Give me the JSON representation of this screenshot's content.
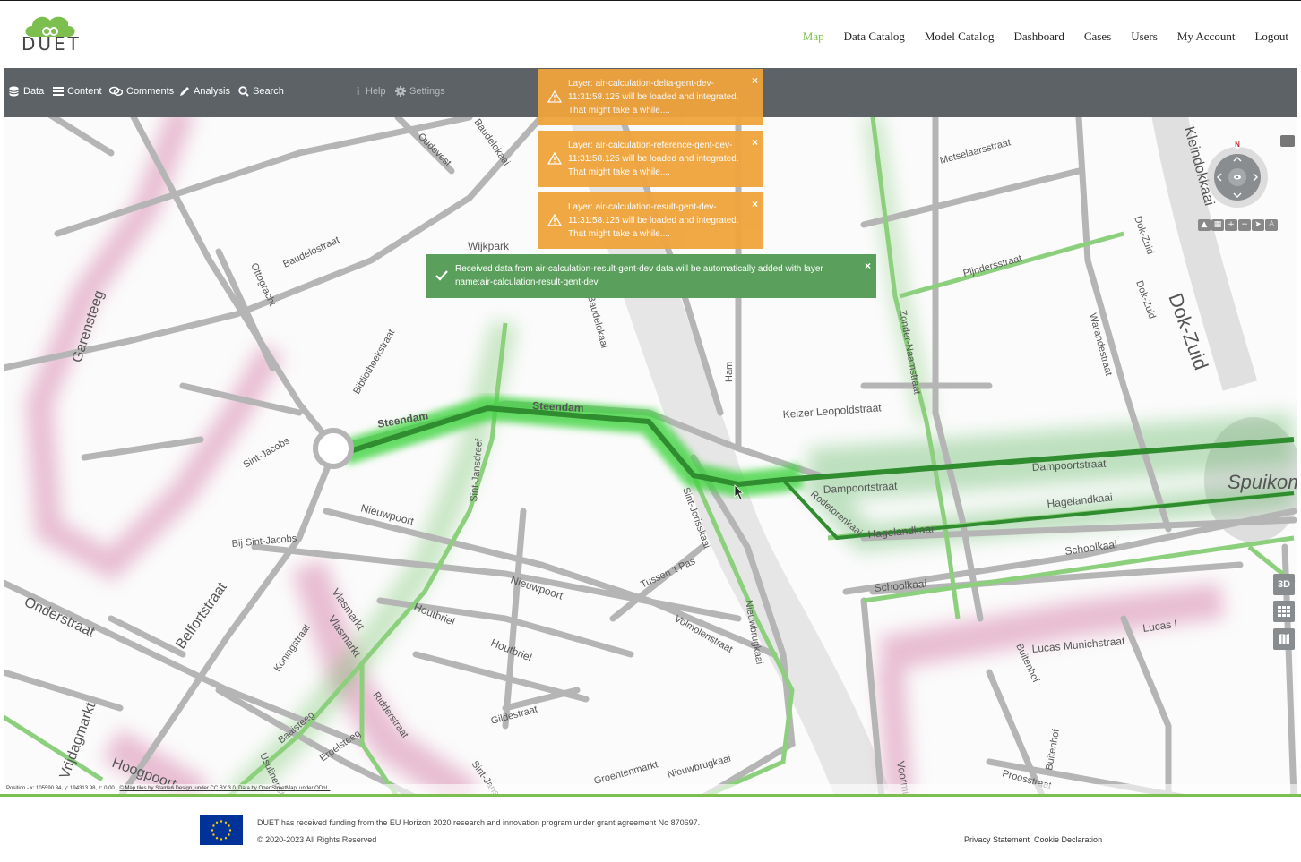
{
  "brand": {
    "logo_text": "DUET"
  },
  "nav": {
    "items": [
      {
        "label": "Map",
        "active": true
      },
      {
        "label": "Data Catalog"
      },
      {
        "label": "Model Catalog"
      },
      {
        "label": "Dashboard"
      },
      {
        "label": "Cases"
      },
      {
        "label": "Users"
      },
      {
        "label": "My Account"
      },
      {
        "label": "Logout"
      }
    ]
  },
  "toolbar": {
    "data": "Data",
    "content": "Content",
    "comments": "Comments",
    "analysis": "Analysis",
    "search": "Search",
    "help": "Help",
    "settings": "Settings"
  },
  "notifications": [
    {
      "text": "Layer: air-calculation-delta-gent-dev-11:31:58.125 will be loaded and integrated. That might take a while....",
      "type": "warning"
    },
    {
      "text": "Layer: air-calculation-reference-gent-dev-11:31:58.125 will be loaded and integrated. That might take a while....",
      "type": "warning"
    },
    {
      "text": "Layer: air-calculation-result-gent-dev-11:31:58.125 will be loaded and integrated. That might take a while....",
      "type": "warning"
    }
  ],
  "success": {
    "text": "Received data from air-calculation-result-gent-dev data will be automatically added with layer name:air-calculation-result-gent-dev"
  },
  "map": {
    "compass_north": "N",
    "side_buttons": {
      "three_d": "3D"
    },
    "position_readout": "Position - x: 105590.34, y: 194313.98, z: 0.00",
    "attribution": "© Map tiles by Stamen Design, under CC BY 3.0. Data by OpenStreetMap, under ODbL.",
    "street_labels": [
      "Steendam",
      "Steendam",
      "Sint-Jansdreef",
      "Sint-Jorisskaai",
      "Nieuwpoort",
      "Nieuwpoort",
      "Houtbriel",
      "Houtbriel",
      "Gildestraat",
      "Vlasmarkt",
      "Vlasmarkt",
      "Koningstraat",
      "Baaisteeg",
      "Erpelsteeg",
      "Ridderstraat",
      "Belfortstraat",
      "Onderstraat",
      "Hoogpoort",
      "Garensteeg",
      "Baudelostraat",
      "Oudevest",
      "Baudelokaai",
      "Baudelokaai",
      "Bibliotheekstraat",
      "Wijkpark",
      "Ham",
      "Keizer Leopoldstraat",
      "Dampoortstraat",
      "Dampoortstraat",
      "Hagelandkaai",
      "Hagelandkaai",
      "Rodetorenkaai",
      "Schoolkaai",
      "Schoolkaai",
      "Lucas Munichstraat",
      "Lucas I",
      "Voormuide",
      "Nieuwbrugkaai",
      "Nieuwbrugkaai",
      "Volmolenstraat",
      "Tussen 't Pas",
      "Zonder-Naamstraat",
      "Pijndersstraat",
      "Metselaarsstraat",
      "Warandestraat",
      "Dok-Zuid",
      "Dok-Zuid",
      "Dok-Zuid",
      "Spuikom",
      "Kleindokkaai",
      "Sint-Jacobs",
      "Bij Sint-Jacobs",
      "Buitenhof",
      "Buitenhof",
      "Proosstraat",
      "Sint-Jansvest",
      "Ottogracht",
      "Usulinenstraat",
      "Vrijdagmarkt",
      "Groentenmarkt"
    ]
  },
  "footer": {
    "funding": "DUET has received funding from the EU Horizon 2020 research and innovation program under grant agreement No 870697.",
    "copyright": "© 2020-2023 All Rights Reserved",
    "privacy": "Privacy Statement",
    "cookie": "Cookie Declaration"
  },
  "colors": {
    "accent": "#7cbf4e",
    "toolbar": "#5c6266",
    "warning": "#f0a43c",
    "success": "#5aa05c",
    "heat_green": "#4caf50",
    "heat_pink": "#d98bb0"
  }
}
